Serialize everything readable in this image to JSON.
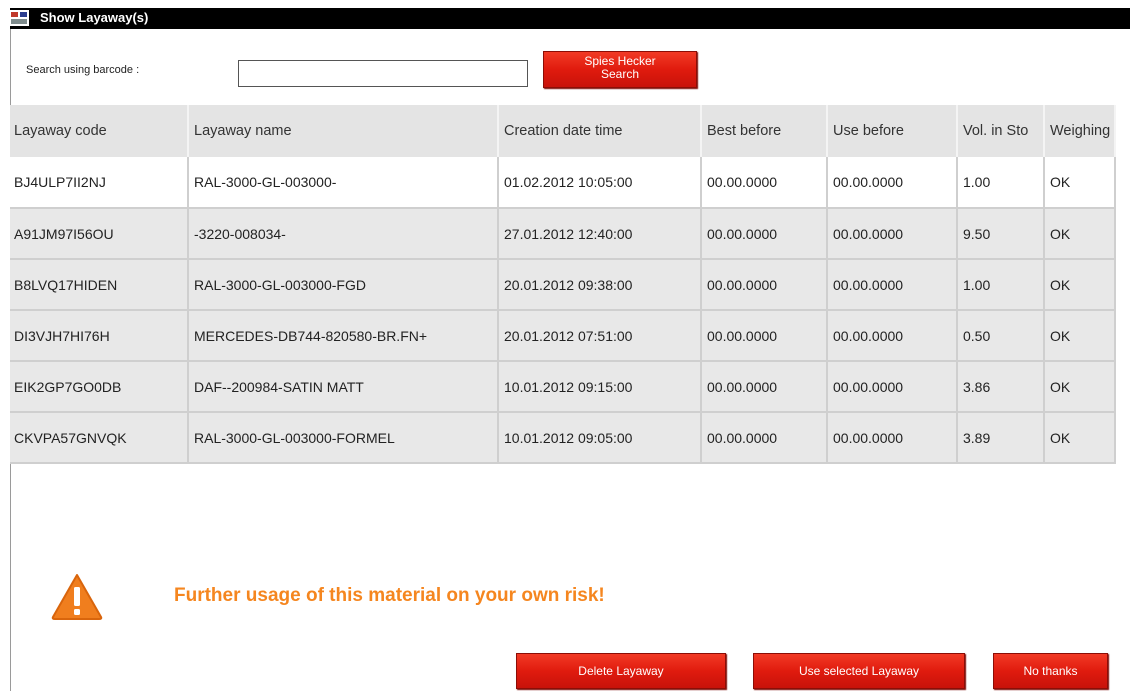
{
  "window": {
    "title": "Show Layaway(s)"
  },
  "search": {
    "label": "Search using barcode :",
    "value": "",
    "button_line1": "Spies Hecker",
    "button_line2": "Search"
  },
  "table": {
    "headers": [
      "Layaway code",
      "Layaway name",
      "Creation date time",
      "Best before",
      "Use before",
      "Vol. in Sto",
      "Weighing"
    ],
    "selected_row": 0,
    "rows": [
      [
        "BJ4ULP7II2NJ",
        "RAL-3000-GL-003000-",
        "01.02.2012 10:05:00",
        "00.00.0000",
        "00.00.0000",
        "1.00",
        "OK"
      ],
      [
        "A91JM97I56OU",
        "-3220-008034-",
        "27.01.2012 12:40:00",
        "00.00.0000",
        "00.00.0000",
        "9.50",
        "OK"
      ],
      [
        "B8LVQ17HIDEN",
        "RAL-3000-GL-003000-FGD",
        "20.01.2012 09:38:00",
        "00.00.0000",
        "00.00.0000",
        "1.00",
        "OK"
      ],
      [
        "DI3VJH7HI76H",
        "MERCEDES-DB744-820580-BR.FN+",
        "20.01.2012 07:51:00",
        "00.00.0000",
        "00.00.0000",
        "0.50",
        "OK"
      ],
      [
        "EIK2GP7GO0DB",
        "DAF--200984-SATIN MATT",
        "10.01.2012 09:15:00",
        "00.00.0000",
        "00.00.0000",
        "3.86",
        "OK"
      ],
      [
        "CKVPA57GNVQK",
        "RAL-3000-GL-003000-FORMEL",
        "10.01.2012 09:05:00",
        "00.00.0000",
        "00.00.0000",
        "3.89",
        "OK"
      ]
    ]
  },
  "warning": {
    "icon": "warning-triangle-icon",
    "text": "Further usage of this material on your own risk!",
    "color": "#f5861f"
  },
  "buttons": {
    "delete_label": "Delete Layaway",
    "use_label": "Use selected Layaway",
    "no_label": "No thanks"
  },
  "colors": {
    "title_bar": "#000000",
    "button_red": "#e01b0e",
    "grid_background": "#e2e2e2",
    "selected_row": "#ffffff"
  }
}
